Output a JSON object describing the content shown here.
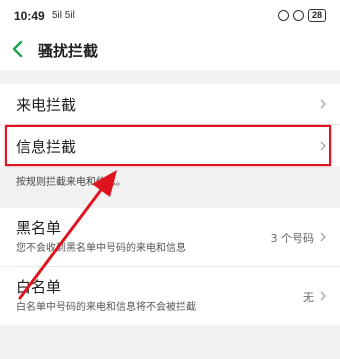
{
  "status_bar": {
    "time": "10:49",
    "network": "5il 5il",
    "battery": "28"
  },
  "header": {
    "title": "骚扰拦截"
  },
  "menu": {
    "call_block": {
      "title": "来电拦截"
    },
    "message_block": {
      "title": "信息拦截"
    },
    "hint": "按规则拦截来电和信息。",
    "blacklist": {
      "title": "黑名单",
      "desc": "您不会收到黑名单中号码的来电和信息",
      "value": "3 个号码"
    },
    "whitelist": {
      "title": "白名单",
      "desc": "白名单中号码的来电和信息将不会被拦截",
      "value": "无"
    }
  },
  "colors": {
    "accent_green": "#1aa34a",
    "highlight_red": "#e0141e"
  },
  "icons": {
    "back": "chevron-left-icon",
    "chevron": "chevron-right-icon",
    "alarm": "alarm-icon",
    "face_unlock": "face-icon"
  }
}
